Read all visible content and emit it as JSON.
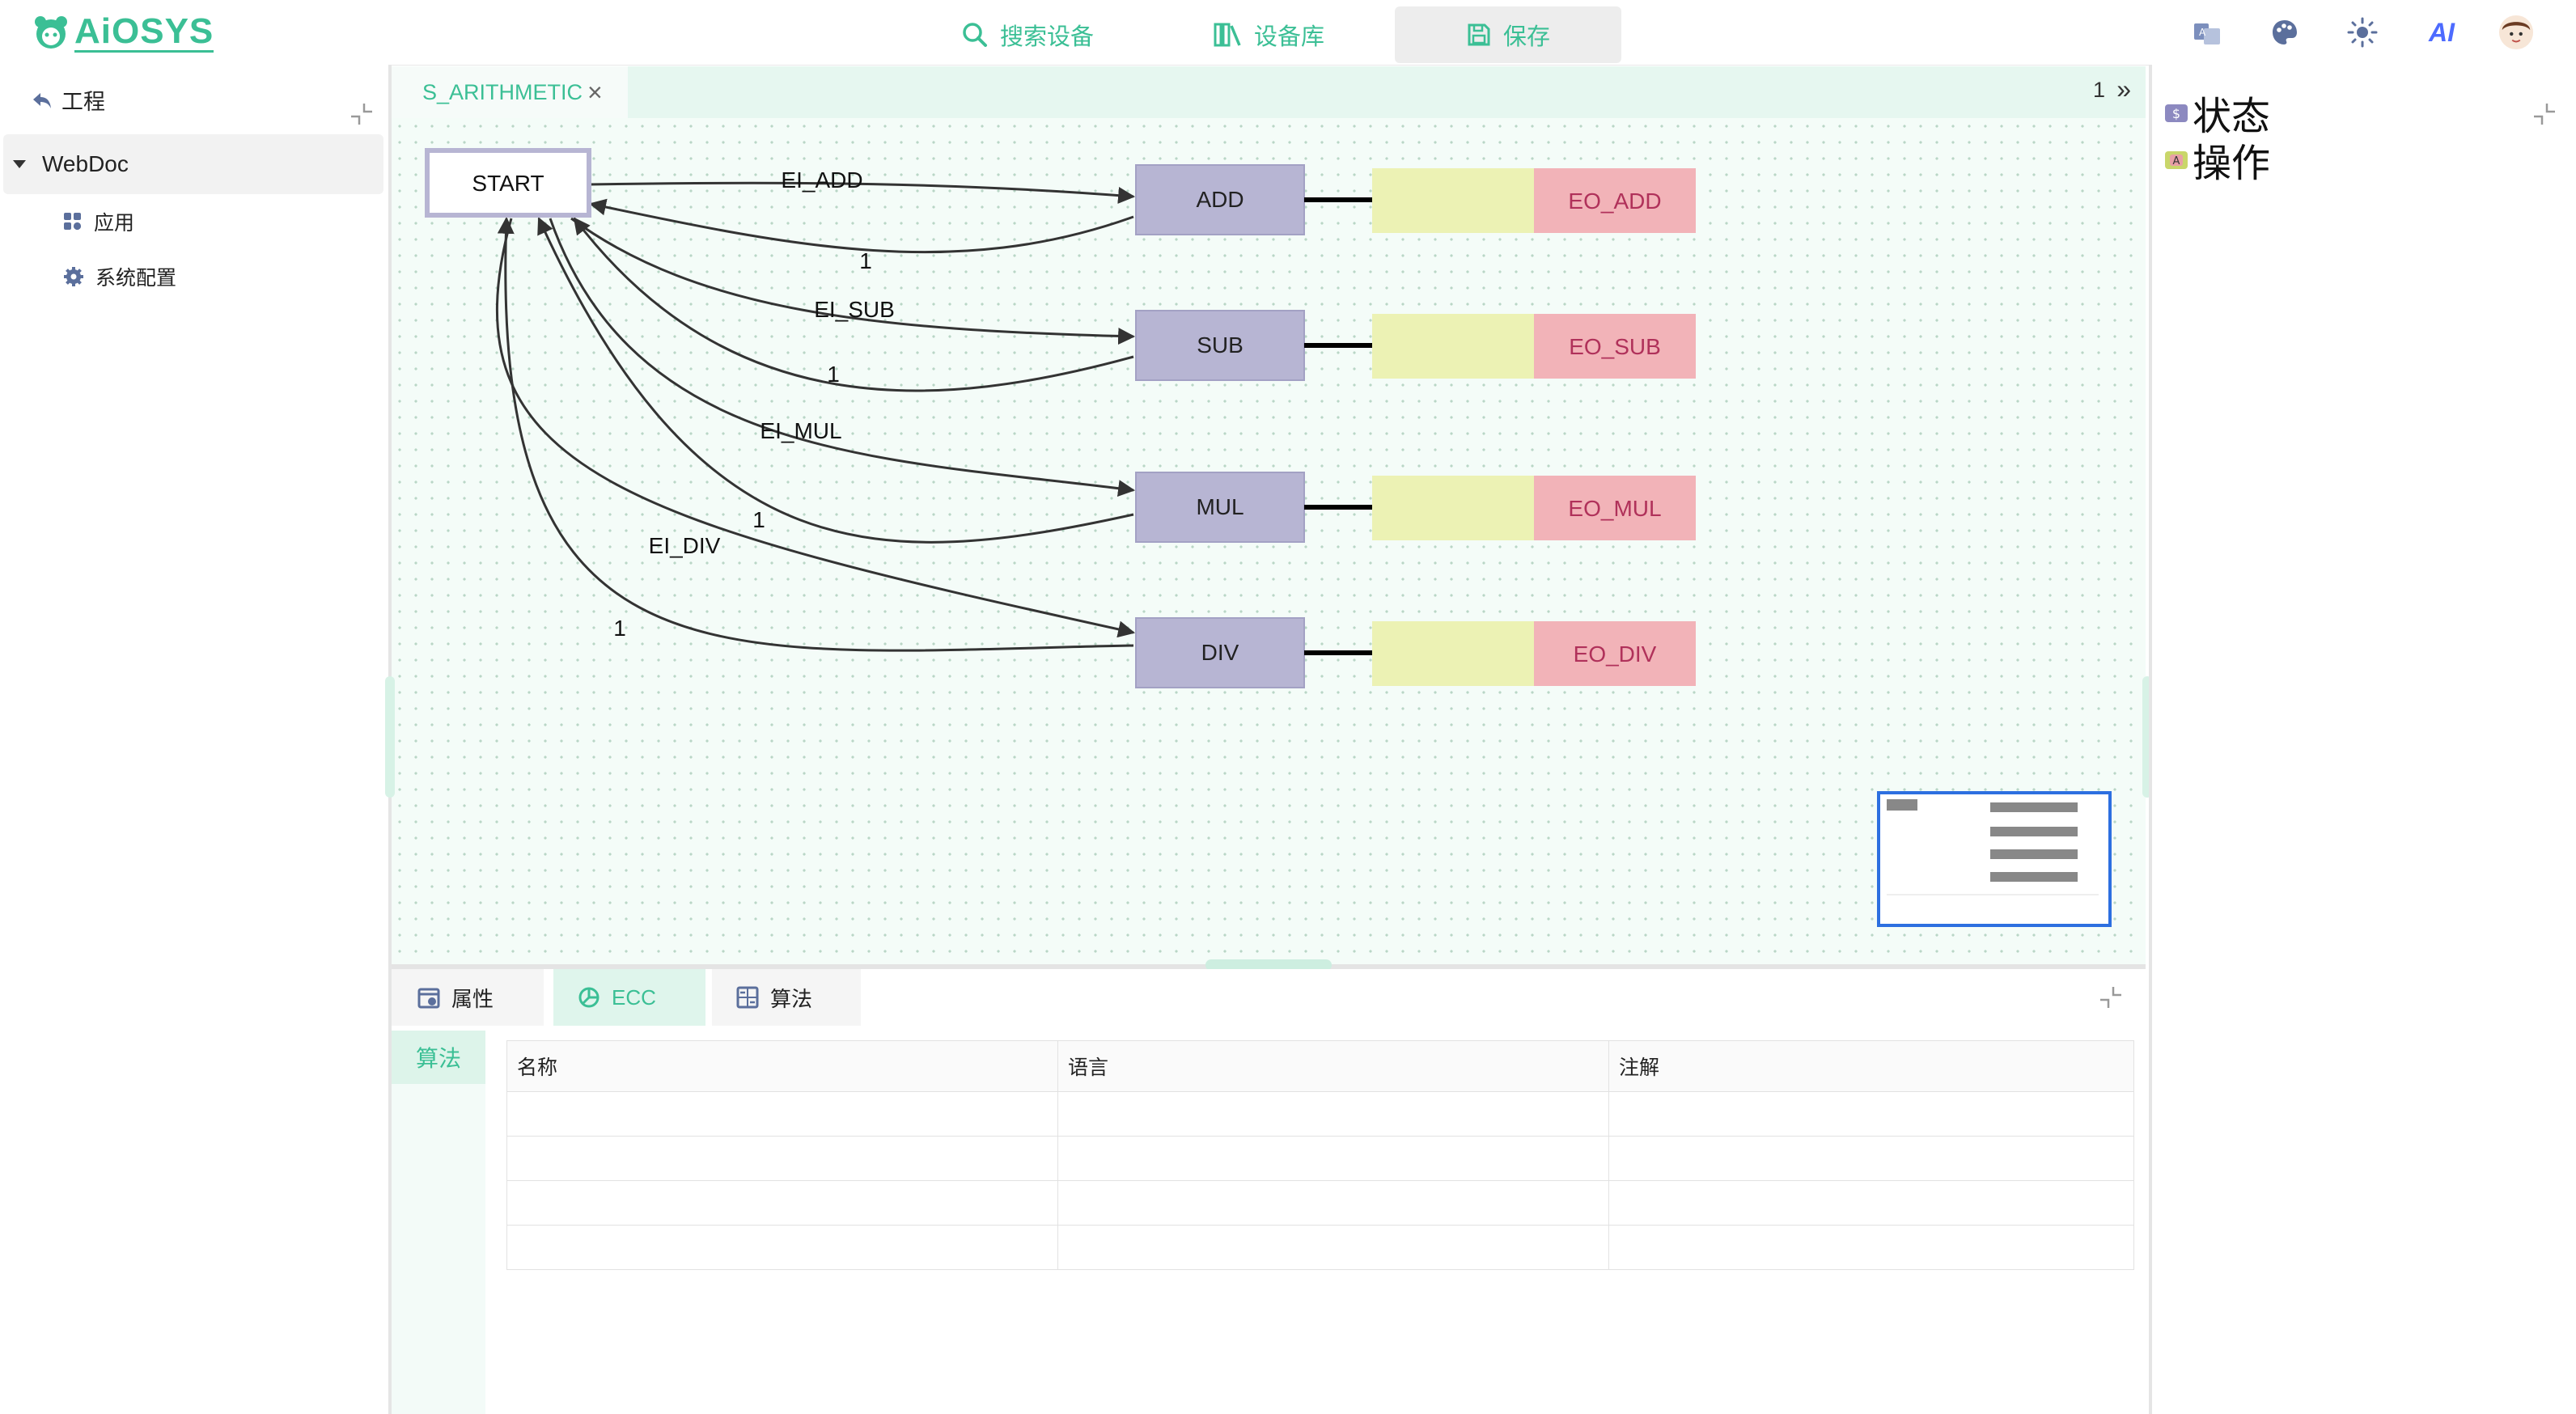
{
  "header": {
    "logo_text": "AiOSYS",
    "nav": [
      {
        "label": "搜索设备",
        "icon": "search-icon"
      },
      {
        "label": "设备库",
        "icon": "library-icon"
      },
      {
        "label": "保存",
        "icon": "save-icon"
      }
    ],
    "right_icons": [
      "translate-icon",
      "palette-icon",
      "sun-icon",
      "ai-icon",
      "user-avatar"
    ],
    "ai_label": "AI"
  },
  "sidebar": {
    "back_label": "工程",
    "tree_root": "WebDoc",
    "items": [
      {
        "label": "应用",
        "icon": "apps-grid-icon"
      },
      {
        "label": "系统配置",
        "icon": "gear-icon"
      }
    ]
  },
  "editor": {
    "tab_name": "S_ARITHMETIC",
    "tab_count": "1",
    "tab_more": "»",
    "diagram": {
      "start_state": "START",
      "states": [
        "ADD",
        "SUB",
        "MUL",
        "DIV"
      ],
      "outputs": [
        "EO_ADD",
        "EO_SUB",
        "EO_MUL",
        "EO_DIV"
      ],
      "transitions_forward": [
        "EI_ADD",
        "EI_SUB",
        "EI_MUL",
        "EI_DIV"
      ],
      "transitions_back": [
        "1",
        "1",
        "1",
        "1"
      ]
    }
  },
  "bottom_panel": {
    "tabs": [
      {
        "label": "属性",
        "icon": "calendar-icon"
      },
      {
        "label": "ECC",
        "icon": "ecc-chart-icon"
      },
      {
        "label": "算法",
        "icon": "algorithm-icon"
      }
    ],
    "active_tab": "ECC",
    "side_tab": "算法",
    "table": {
      "columns": [
        "名称",
        "语言",
        "注解"
      ],
      "rows": [
        [
          "",
          "",
          ""
        ],
        [
          "",
          "",
          ""
        ],
        [
          "",
          "",
          ""
        ],
        [
          "",
          "",
          ""
        ]
      ]
    }
  },
  "right_panel": {
    "items": [
      {
        "label": "状态",
        "icon": "state-icon"
      },
      {
        "label": "操作",
        "icon": "action-icon"
      }
    ]
  },
  "colors": {
    "accent": "#3bbf95",
    "state_fill": "#b7b5d3",
    "algorithm_fill": "#ecf2b4",
    "output_fill": "#f2b3b8",
    "output_text": "#b0315a",
    "canvas_bg": "#f4fcf8",
    "minimap_border": "#2d6fe0"
  }
}
